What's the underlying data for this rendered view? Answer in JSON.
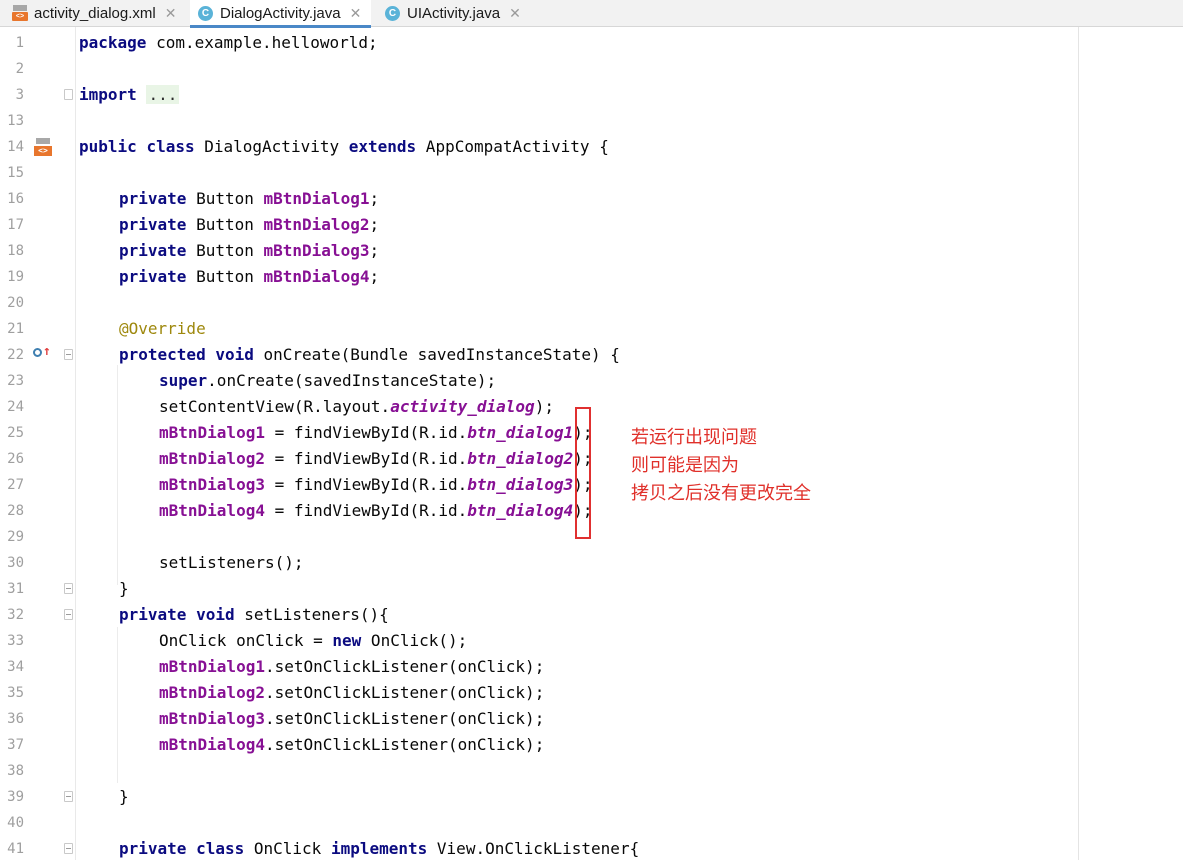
{
  "tabs": [
    {
      "label": "activity_dialog.xml",
      "icon": "xml-file-icon"
    },
    {
      "label": "DialogActivity.java",
      "icon": "java-class-icon",
      "active": true
    },
    {
      "label": "UIActivity.java",
      "icon": "java-class-icon"
    }
  ],
  "close_glyph": "✕",
  "class_icon_letter": "C",
  "xml_icon_glyph": "<>",
  "line_numbers": [
    "1",
    "2",
    "3",
    "13",
    "14",
    "15",
    "16",
    "17",
    "18",
    "19",
    "20",
    "21",
    "22",
    "23",
    "24",
    "25",
    "26",
    "27",
    "28",
    "29",
    "30",
    "31",
    "32",
    "33",
    "34",
    "35",
    "36",
    "37",
    "38",
    "39",
    "40",
    "41"
  ],
  "code": {
    "l1": [
      "package",
      " com.example.helloworld;"
    ],
    "l3": [
      "import",
      " ",
      "..."
    ],
    "l14": [
      "public",
      " ",
      "class",
      " DialogActivity ",
      "extends",
      " AppCompatActivity {"
    ],
    "l16": [
      "private",
      " Button ",
      "mBtnDialog1",
      ";"
    ],
    "l17": [
      "private",
      " Button ",
      "mBtnDialog2",
      ";"
    ],
    "l18": [
      "private",
      " Button ",
      "mBtnDialog3",
      ";"
    ],
    "l19": [
      "private",
      " Button ",
      "mBtnDialog4",
      ";"
    ],
    "l21": [
      "@Override"
    ],
    "l22": [
      "protected",
      " ",
      "void",
      " onCreate(Bundle savedInstanceState) {"
    ],
    "l23": [
      "super",
      ".onCreate(savedInstanceState);"
    ],
    "l24": [
      "setContentView(R.layout.",
      "activity_dialog",
      ");"
    ],
    "l25": [
      "mBtnDialog1",
      " = findViewById(R.id.",
      "btn_dialog1",
      ");"
    ],
    "l26": [
      "mBtnDialog2",
      " = findViewById(R.id.",
      "btn_dialog2",
      ");"
    ],
    "l27": [
      "mBtnDialog3",
      " = findViewById(R.id.",
      "btn_dialog3",
      ");"
    ],
    "l28": [
      "mBtnDialog4",
      " = findViewById(R.id.",
      "btn_dialog4",
      ");"
    ],
    "l30": [
      "setListeners();"
    ],
    "l31": [
      "}"
    ],
    "l32": [
      "private",
      " ",
      "void",
      " setListeners(){"
    ],
    "l33": [
      "OnClick onClick = ",
      "new",
      " OnClick();"
    ],
    "l34": [
      "mBtnDialog1",
      ".setOnClickListener(onClick);"
    ],
    "l35": [
      "mBtnDialog2",
      ".setOnClickListener(onClick);"
    ],
    "l36": [
      "mBtnDialog3",
      ".setOnClickListener(onClick);"
    ],
    "l37": [
      "mBtnDialog4",
      ".setOnClickListener(onClick);"
    ],
    "l39": [
      "}"
    ],
    "l41": [
      "private",
      " ",
      "class",
      " OnClick ",
      "implements",
      " View.OnClickListener{"
    ]
  },
  "annotation": {
    "lines": [
      "若运行出现问题",
      "则可能是因为",
      "拷贝之后没有更改完全"
    ],
    "color": "#e0302a"
  },
  "colors": {
    "keyword": "#0b0b80",
    "field": "#871094",
    "annotation": "#9e880d",
    "tab_active_underline": "#4a88c7"
  }
}
